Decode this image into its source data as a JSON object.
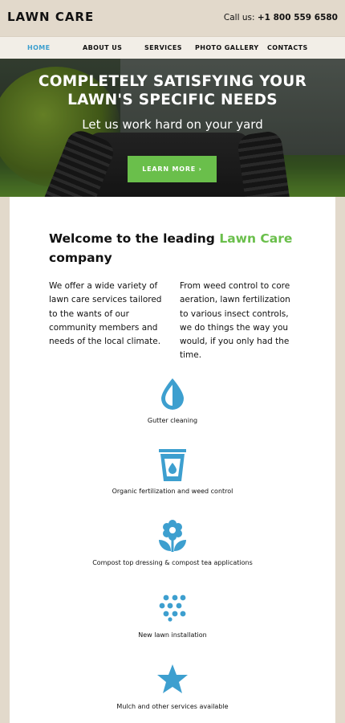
{
  "header": {
    "logo": "LAWN CARE",
    "phone_label": "Call us:",
    "phone_number": "+1 800 559 6580"
  },
  "nav": {
    "items": [
      {
        "label": "HOME",
        "active": true
      },
      {
        "label": "ABOUT US",
        "active": false
      },
      {
        "label": "SERVICES",
        "active": false
      },
      {
        "label": "PHOTO GALLERY",
        "active": false
      },
      {
        "label": "CONTACTS",
        "active": false
      }
    ]
  },
  "hero": {
    "title_line1": "COMPLETELY SATISFYING YOUR",
    "title_line2": "LAWN'S SPECIFIC NEEDS",
    "subtitle": "Let us work hard on your yard",
    "button_label": "LEARN MORE ›"
  },
  "welcome": {
    "heading_prefix": "Welcome to the leading",
    "heading_accent": "Lawn Care",
    "heading_suffix": "company"
  },
  "intro": {
    "left_text": "We offer a wide variety of lawn care services tailored to the wants of our community members and needs of the local climate.",
    "right_text": "From weed control to core aeration, lawn fertilization to various insect controls, we do things the way you would, if you only had the time."
  },
  "features": [
    {
      "icon": "water-drop-icon",
      "label": "Gutter cleaning"
    },
    {
      "icon": "glass-icon",
      "label": "Organic fertilization and weed control"
    },
    {
      "icon": "flower-icon",
      "label": "Compost top dressing & compost tea applications"
    },
    {
      "icon": "seeds-icon",
      "label": "New lawn installation"
    },
    {
      "icon": "star-icon",
      "label": "Mulch and other services available"
    }
  ],
  "colors": {
    "accent_green": "#6abf4b",
    "accent_blue": "#3d9fcf",
    "frame_beige": "#e2d9cb"
  }
}
